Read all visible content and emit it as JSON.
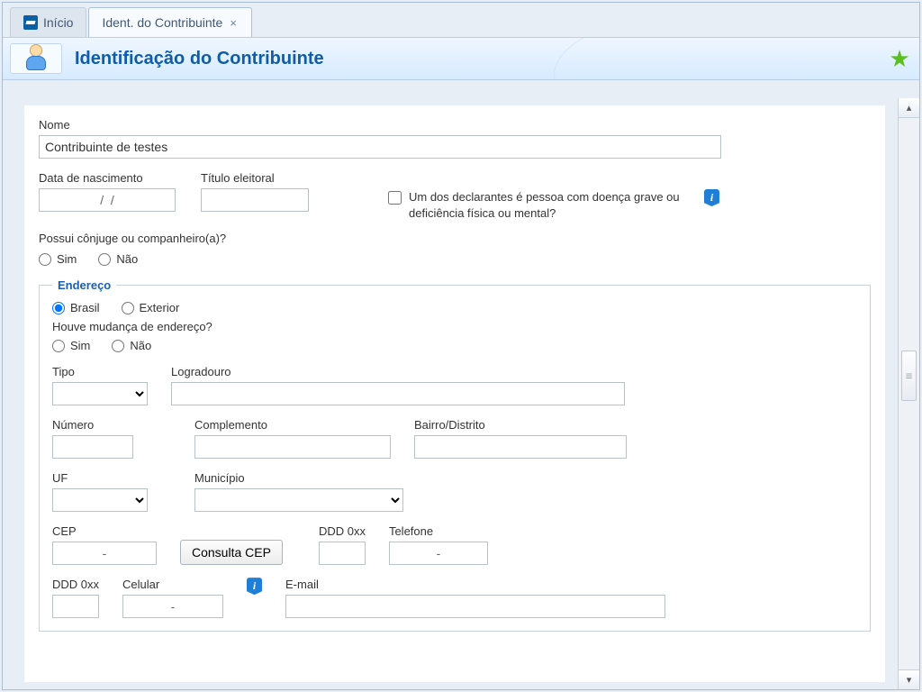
{
  "tabs": {
    "home": "Início",
    "contrib": "Ident. do Contribuinte"
  },
  "page": {
    "title": "Identificação do Contribuinte"
  },
  "form": {
    "nome_label": "Nome",
    "nome_value": "Contribuinte de testes",
    "nasc_label": "Data de nascimento",
    "nasc_value": "/  /",
    "titulo_label": "Título eleitoral",
    "doenca_text": "Um dos declarantes é pessoa com doença grave ou deficiência física ou mental?",
    "conjuge_q": "Possui cônjuge ou companheiro(a)?",
    "sim": "Sim",
    "nao": "Não",
    "addr_legend": "Endereço",
    "brasil": "Brasil",
    "exterior": "Exterior",
    "mudanca_q": "Houve mudança de endereço?",
    "tipo": "Tipo",
    "logradouro": "Logradouro",
    "numero": "Número",
    "complemento": "Complemento",
    "bairro": "Bairro/Distrito",
    "uf": "UF",
    "municipio": "Município",
    "cep": "CEP",
    "cep_val": "-",
    "consulta_cep": "Consulta CEP",
    "ddd": "DDD 0xx",
    "telefone": "Telefone",
    "telefone_val": "-",
    "celular": "Celular",
    "celular_val": "-",
    "email": "E-mail"
  }
}
